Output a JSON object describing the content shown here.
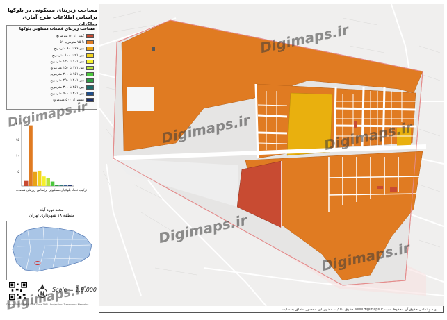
{
  "title": {
    "line1": "مساحت زیربنای مسکونی در بلوکها",
    "line2": "براساس اطلاعات طرح آماری ساکنان"
  },
  "legend": {
    "header": "مساحت زیربنای قطعات مسکونی بلوکها",
    "items": [
      {
        "label": "کمتر از ۵۰ مترمربع",
        "color": "#c84b32"
      },
      {
        "label": "۵۱ تا ۷۵ مترمربع",
        "color": "#e07b22"
      },
      {
        "label": "بین ۷۶ تا ۹۰ مترمربع",
        "color": "#e9a316"
      },
      {
        "label": "بین ۹۱ تا ۱۰۰ مترمربع",
        "color": "#f2d21d"
      },
      {
        "label": "بین ۱۰۱ تا ۱۲۰ مترمربع",
        "color": "#f5ef2a"
      },
      {
        "label": "بین ۱۲۱ تا ۱۵۰ مترمربع",
        "color": "#b6e33a"
      },
      {
        "label": "بین ۱۵۱ تا ۲۰۰ مترمربع",
        "color": "#4cc83d"
      },
      {
        "label": "بین ۲۰۱ تا ۲۵۰ مترمربع",
        "color": "#2f9b44"
      },
      {
        "label": "بین ۲۵۱ تا ۳۰۰ مترمربع",
        "color": "#1f6b6a"
      },
      {
        "label": "بین ۳۰۱ تا ۵۰۰ مترمربع",
        "color": "#204e8a"
      },
      {
        "label": "بیشتر از ۵۰۰ مترمربع",
        "color": "#1b2f6b"
      }
    ]
  },
  "chart_data": {
    "type": "bar",
    "categories": [
      "1",
      "2",
      "3",
      "4",
      "5",
      "6",
      "7",
      "8",
      "9",
      "10",
      "11"
    ],
    "values": [
      8,
      95,
      22,
      24,
      15,
      13,
      7,
      2,
      1,
      1,
      1
    ],
    "colors": [
      "#c84b32",
      "#e07b22",
      "#e9a316",
      "#f2d21d",
      "#f5ef2a",
      "#b6e33a",
      "#4cc83d",
      "#2f9b44",
      "#1f6b6a",
      "#204e8a",
      "#1b2f6b"
    ],
    "yticks": [
      "۲۰",
      "۱۵",
      "۱۰",
      "۵"
    ],
    "caption": "ترکیب تعداد بلوکهای مسکونی براساس زیربنای قطعات"
  },
  "district": {
    "name": "محله نورد آباد",
    "region": "منطقه ۱۸ شهرداری تهران"
  },
  "scale": "Scale = 1:9,000",
  "north_label": "N",
  "credit": "Datum: WGS 1984 UTM Zone 39N | Projection: Transverse Mercator",
  "footer": "حقوق مالکیت معنوی این محصول متعلق به سایت www.digimaps.ir بوده و تمامی حقوق آن محفوظ است.",
  "watermark": "Digimaps.ir",
  "colors": {
    "dark_red": "#c84b32",
    "orange": "#e07b22",
    "yellow": "#e9b00e",
    "border_pink": "#e48b8b",
    "road": "#ffffff"
  }
}
